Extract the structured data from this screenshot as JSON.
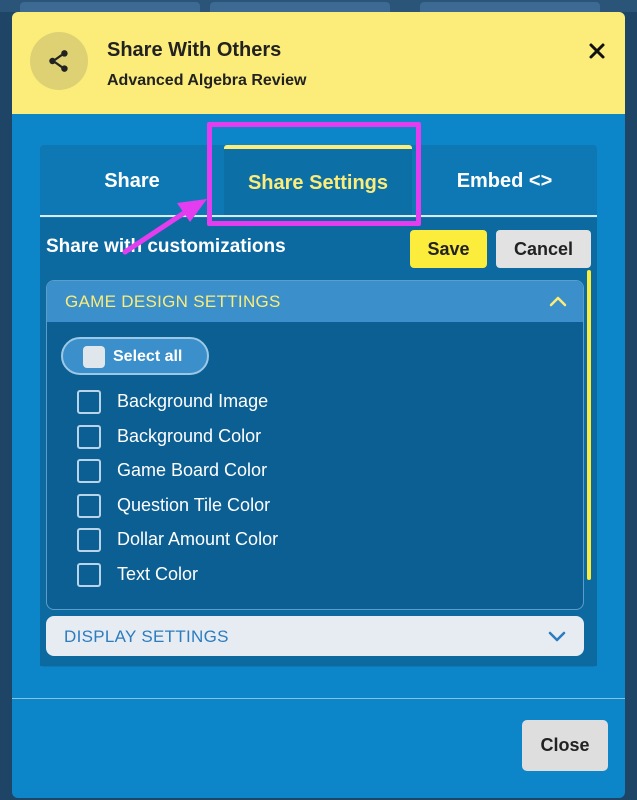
{
  "dialog": {
    "title": "Share With Others",
    "subtitle": "Advanced Algebra Review"
  },
  "tabs": [
    {
      "label": "Share",
      "active": false
    },
    {
      "label": "Share Settings",
      "active": true
    },
    {
      "label": "Embed <>",
      "active": false
    }
  ],
  "content": {
    "heading": "Share with customizations",
    "save_label": "Save",
    "cancel_label": "Cancel"
  },
  "game_design": {
    "title": "GAME DESIGN SETTINGS",
    "expanded": true,
    "select_all_label": "Select all",
    "options": [
      {
        "label": "Background Image",
        "checked": false
      },
      {
        "label": "Background Color",
        "checked": false
      },
      {
        "label": "Game Board Color",
        "checked": false
      },
      {
        "label": "Question Tile Color",
        "checked": false
      },
      {
        "label": "Dollar Amount Color",
        "checked": false
      },
      {
        "label": "Text Color",
        "checked": false
      }
    ]
  },
  "display_settings": {
    "title": "DISPLAY SETTINGS",
    "expanded": false
  },
  "footer": {
    "close_label": "Close"
  },
  "icons": {
    "share": "share-icon",
    "close": "close-icon",
    "chevron_up": "chevron-up-icon",
    "chevron_down": "chevron-down-icon"
  },
  "colors": {
    "header_bg": "#fcec79",
    "modal_bg": "#0d86c9",
    "accent_yellow": "#fcec3c",
    "highlight": "#e43df0"
  }
}
